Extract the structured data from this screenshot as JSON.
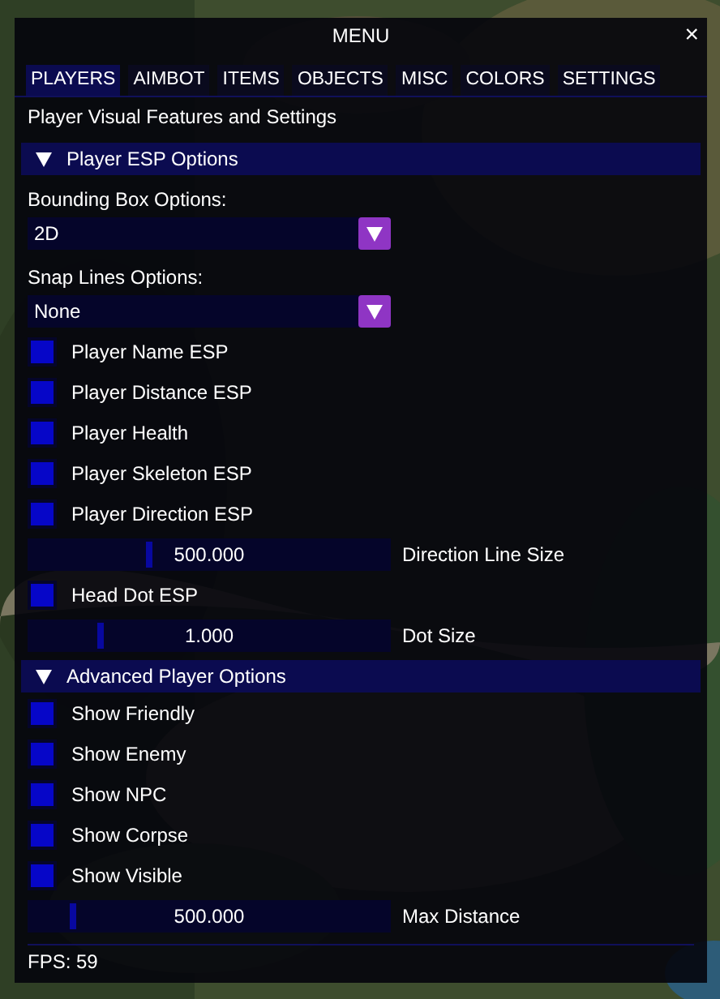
{
  "window": {
    "title": "MENU",
    "close": "×"
  },
  "tabs": [
    {
      "label": "PLAYERS",
      "selected": true
    },
    {
      "label": "AIMBOT",
      "selected": false
    },
    {
      "label": "ITEMS",
      "selected": false
    },
    {
      "label": "OBJECTS",
      "selected": false
    },
    {
      "label": "MISC",
      "selected": false
    },
    {
      "label": "COLORS",
      "selected": false
    },
    {
      "label": "SETTINGS",
      "selected": false
    }
  ],
  "description": "Player Visual Features and Settings",
  "sections": [
    {
      "title": "Player ESP Options",
      "expanded": true,
      "items": [
        {
          "kind": "combo",
          "label": "Bounding Box Options:",
          "value": "2D"
        },
        {
          "kind": "combo",
          "label": "Snap Lines Options:",
          "value": "None"
        },
        {
          "kind": "checkbox",
          "label": "Player Name ESP",
          "checked": false
        },
        {
          "kind": "checkbox",
          "label": "Player Distance ESP",
          "checked": false
        },
        {
          "kind": "checkbox",
          "label": "Player Health",
          "checked": false
        },
        {
          "kind": "checkbox",
          "label": "Player Skeleton ESP",
          "checked": false
        },
        {
          "kind": "checkbox",
          "label": "Player Direction ESP",
          "checked": false
        },
        {
          "kind": "slider",
          "label": "Direction Line Size",
          "reading": "500.000",
          "level": 0.33
        },
        {
          "kind": "checkbox",
          "label": "Head Dot ESP",
          "checked": false
        },
        {
          "kind": "slider",
          "label": "Dot Size",
          "reading": "1.000",
          "level": 0.19
        }
      ]
    },
    {
      "title": "Advanced Player Options",
      "expanded": true,
      "items": [
        {
          "kind": "checkbox",
          "label": "Show Friendly",
          "checked": false
        },
        {
          "kind": "checkbox",
          "label": "Show Enemy",
          "checked": false
        },
        {
          "kind": "checkbox",
          "label": "Show NPC",
          "checked": false
        },
        {
          "kind": "checkbox",
          "label": "Show Corpse",
          "checked": false
        },
        {
          "kind": "checkbox",
          "label": "Show Visible",
          "checked": false
        },
        {
          "kind": "slider",
          "label": "Max Distance",
          "reading": "500.000",
          "level": 0.11
        }
      ]
    }
  ],
  "status": "FPS: 59"
}
